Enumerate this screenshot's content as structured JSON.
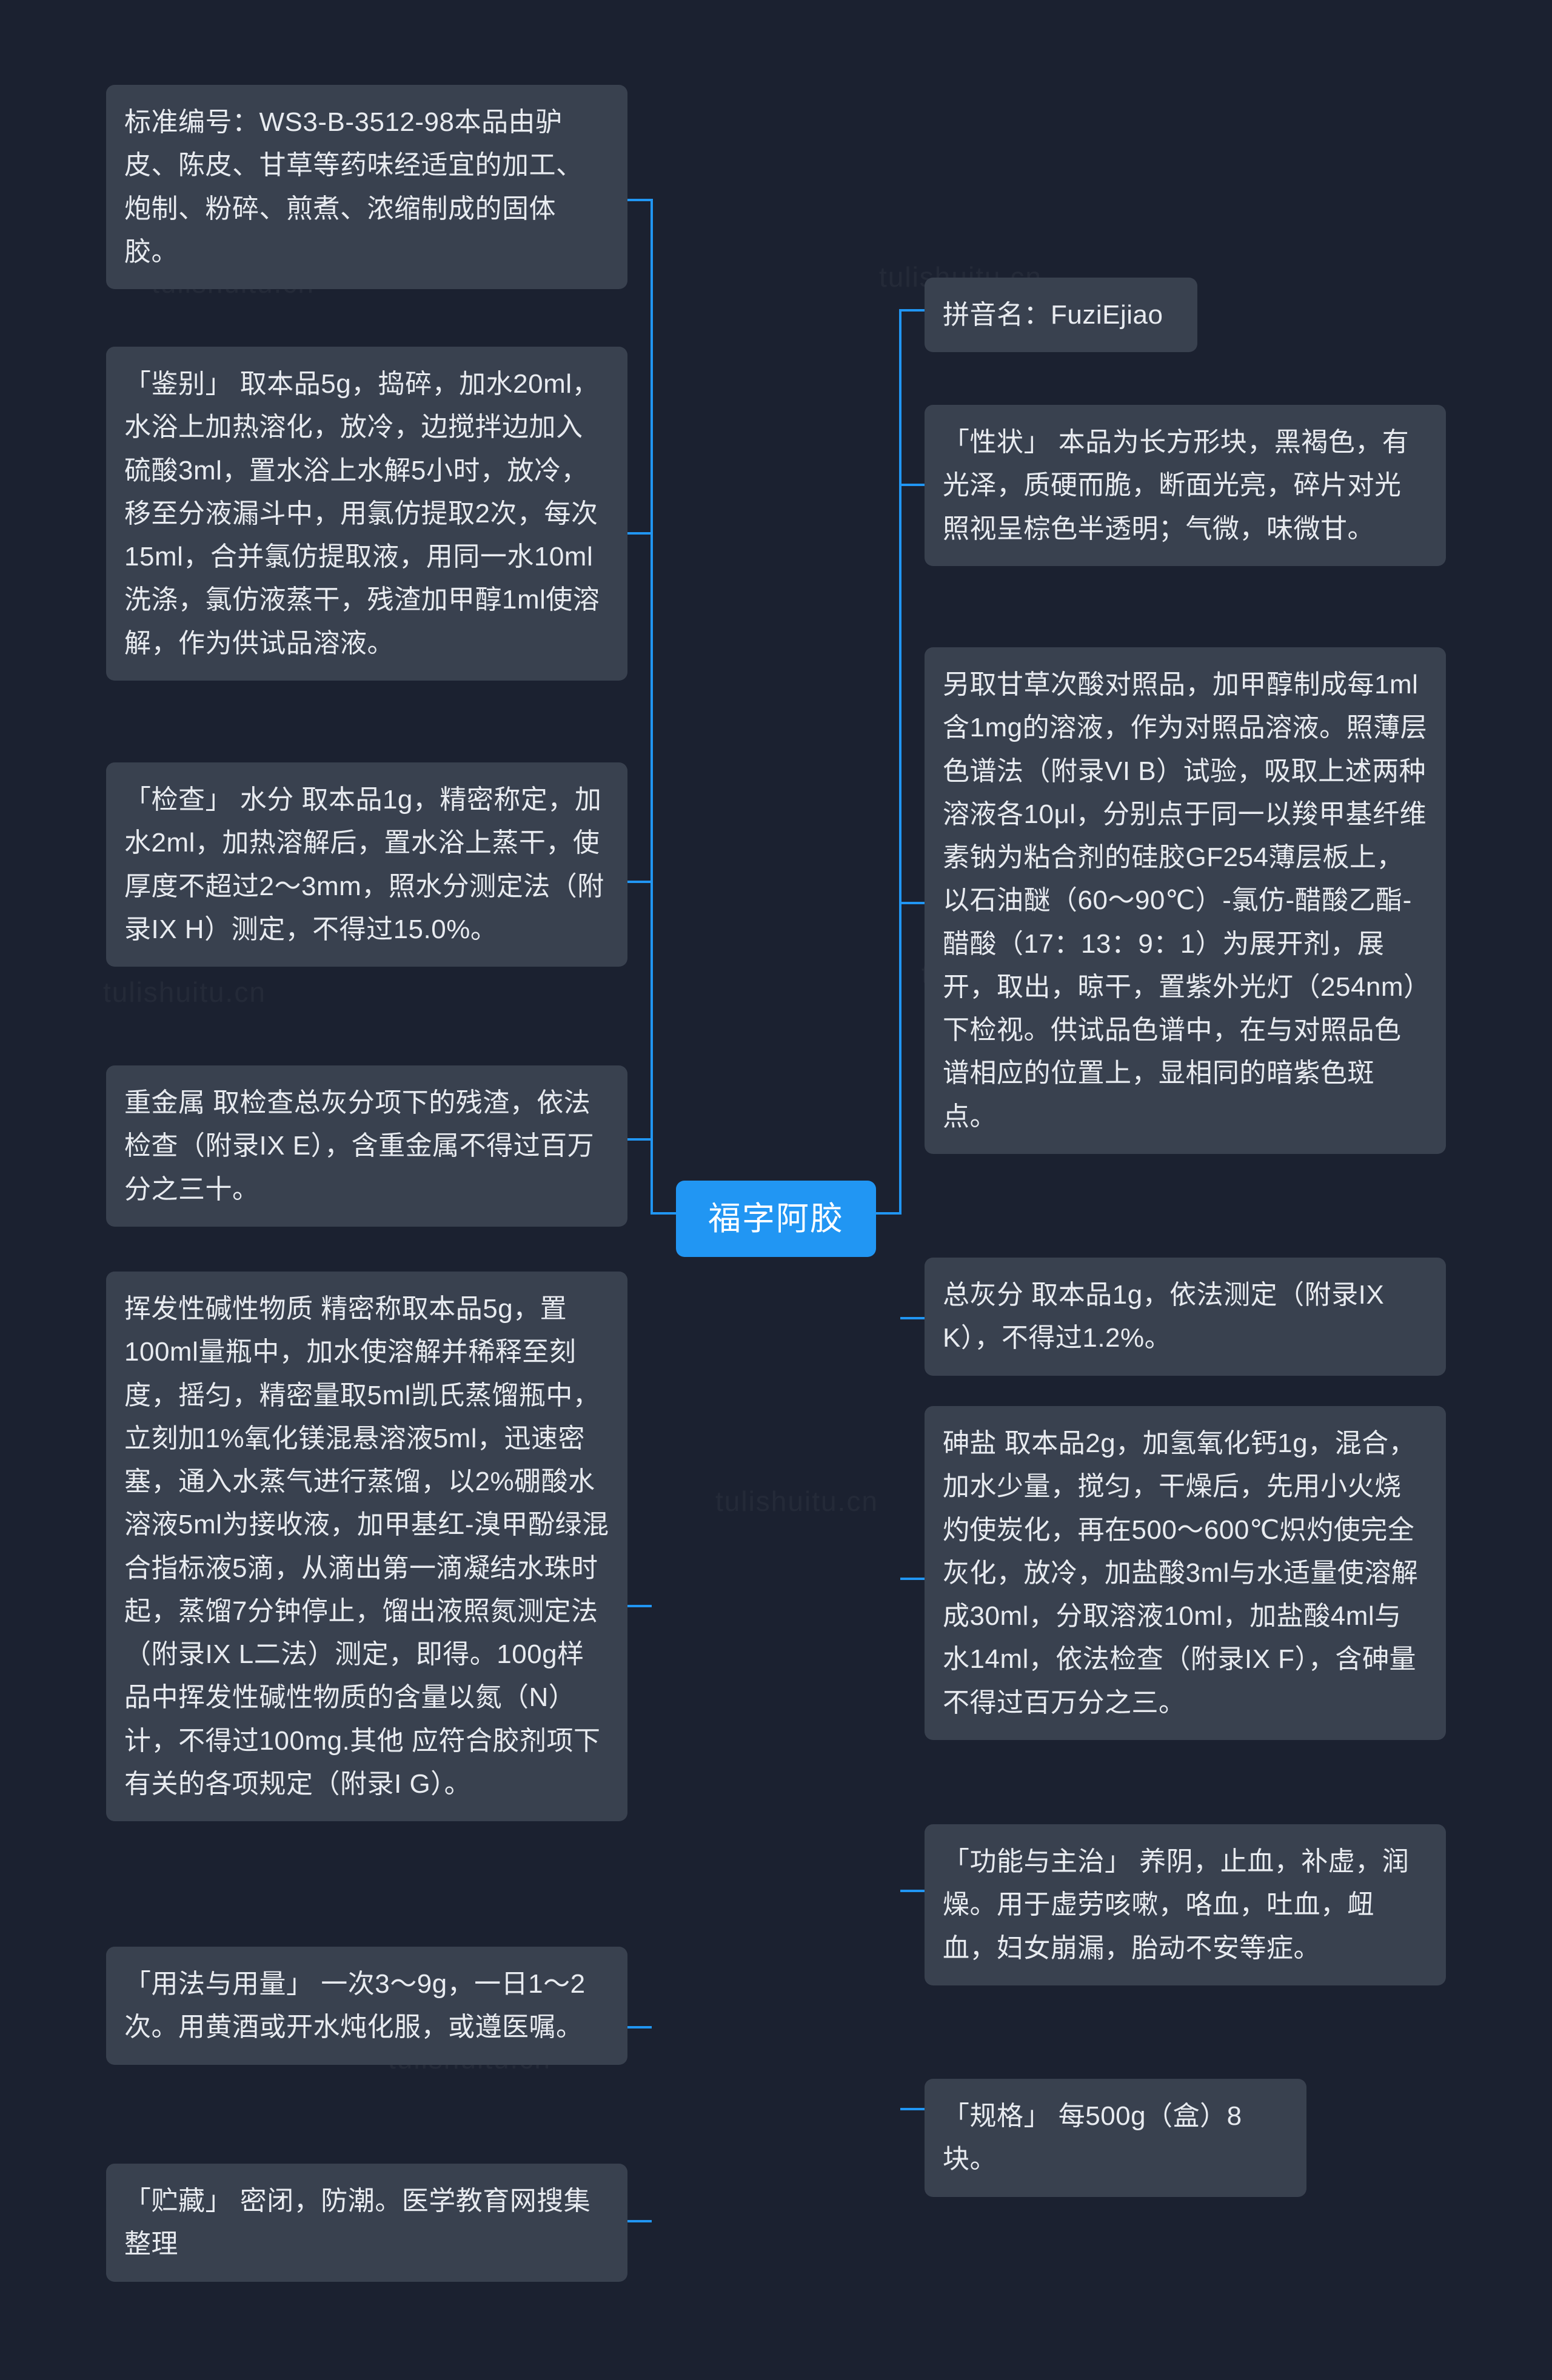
{
  "root": {
    "label": "福字阿胶"
  },
  "watermarks": [
    "tulishuitu.cn",
    "tulishuitu.cn",
    "tulishuitu.cn",
    "tulishuitu.cn",
    "tulishuitu.cn",
    "tulishuitu.cn",
    "tulishuitu.cn"
  ],
  "left_nodes": [
    {
      "id": "standard-number",
      "text": "标准编号：WS3-B-3512-98本品由驴皮、陈皮、甘草等药味经适宜的加工、炮制、粉碎、煎煮、浓缩制成的固体胶。"
    },
    {
      "id": "identification",
      "text": "「鉴别」 取本品5g，捣碎，加水20ml，水浴上加热溶化，放冷，边搅拌边加入硫酸3ml，置水浴上水解5小时，放冷，移至分液漏斗中，用氯仿提取2次，每次15ml，合并氯仿提取液，用同一水10ml洗涤，氯仿液蒸干，残渣加甲醇1ml使溶解，作为供试品溶液。"
    },
    {
      "id": "inspection-moisture",
      "text": "「检查」 水分 取本品1g，精密称定，加水2ml，加热溶解后，置水浴上蒸干，使厚度不超过2～3mm，照水分测定法（附录IX H）测定，不得过15.0%。"
    },
    {
      "id": "heavy-metals",
      "text": "重金属 取检查总灰分项下的残渣，依法检查（附录IX E），含重金属不得过百万分之三十。"
    },
    {
      "id": "volatile-alkaline",
      "text": "挥发性碱性物质 精密称取本品5g，置100ml量瓶中，加水使溶解并稀释至刻度，摇匀，精密量取5ml凯氏蒸馏瓶中，立刻加1%氧化镁混悬溶液5ml，迅速密塞，通入水蒸气进行蒸馏，以2%硼酸水溶液5ml为接收液，加甲基红-溴甲酚绿混合指标液5滴，从滴出第一滴凝结水珠时起，蒸馏7分钟停止，馏出液照氮测定法（附录IX L二法）测定，即得。100g样品中挥发性碱性物质的含量以氮（N）计，不得过100mg.其他 应符合胶剂项下有关的各项规定（附录I G）。"
    },
    {
      "id": "usage-dosage",
      "text": "「用法与用量」 一次3～9g，一日1～2次。用黄酒或开水炖化服，或遵医嘱。"
    },
    {
      "id": "storage",
      "text": "「贮藏」 密闭，防潮。医学教育网搜集整理"
    }
  ],
  "right_nodes": [
    {
      "id": "pinyin-name",
      "text": "拼音名：FuziEjiao"
    },
    {
      "id": "properties",
      "text": "「性状」 本品为长方形块，黑褐色，有光泽，质硬而脆，断面光亮，碎片对光照视呈棕色半透明；气微，味微甘。"
    },
    {
      "id": "tlc-test",
      "text": "另取甘草次酸对照品，加甲醇制成每1ml含1mg的溶液，作为对照品溶液。照薄层色谱法（附录VI B）试验，吸取上述两种溶液各10μl，分别点于同一以羧甲基纤维素钠为粘合剂的硅胶GF254薄层板上，以石油醚（60～90℃）‐氯仿‐醋酸乙酯‐醋酸（17：13：9：1）为展开剂，展开，取出，晾干，置紫外光灯（254nm）下检视。供试品色谱中，在与对照品色谱相应的位置上，显相同的暗紫色斑点。"
    },
    {
      "id": "total-ash",
      "text": "总灰分 取本品1g，依法测定（附录IX K），不得过1.2%。"
    },
    {
      "id": "arsenic-salt",
      "text": "砷盐 取本品2g，加氢氧化钙1g，混合，加水少量，搅匀，干燥后，先用小火烧灼使炭化，再在500～600℃炽灼使完全灰化，放冷，加盐酸3ml与水适量使溶解成30ml，分取溶液10ml，加盐酸4ml与水14ml，依法检查（附录IX F），含砷量不得过百万分之三。"
    },
    {
      "id": "function-indication",
      "text": "「功能与主治」 养阴，止血，补虚，润燥。用于虚劳咳嗽，咯血，吐血，衄血，妇女崩漏，胎动不安等症。"
    },
    {
      "id": "specification",
      "text": "「规格」 每500g（盒）8块。"
    }
  ],
  "colors": {
    "background": "#1b2130",
    "node_bg": "#39414f",
    "root_bg": "#2196f3",
    "text": "#e8ebf0",
    "link": "#2196f3"
  }
}
